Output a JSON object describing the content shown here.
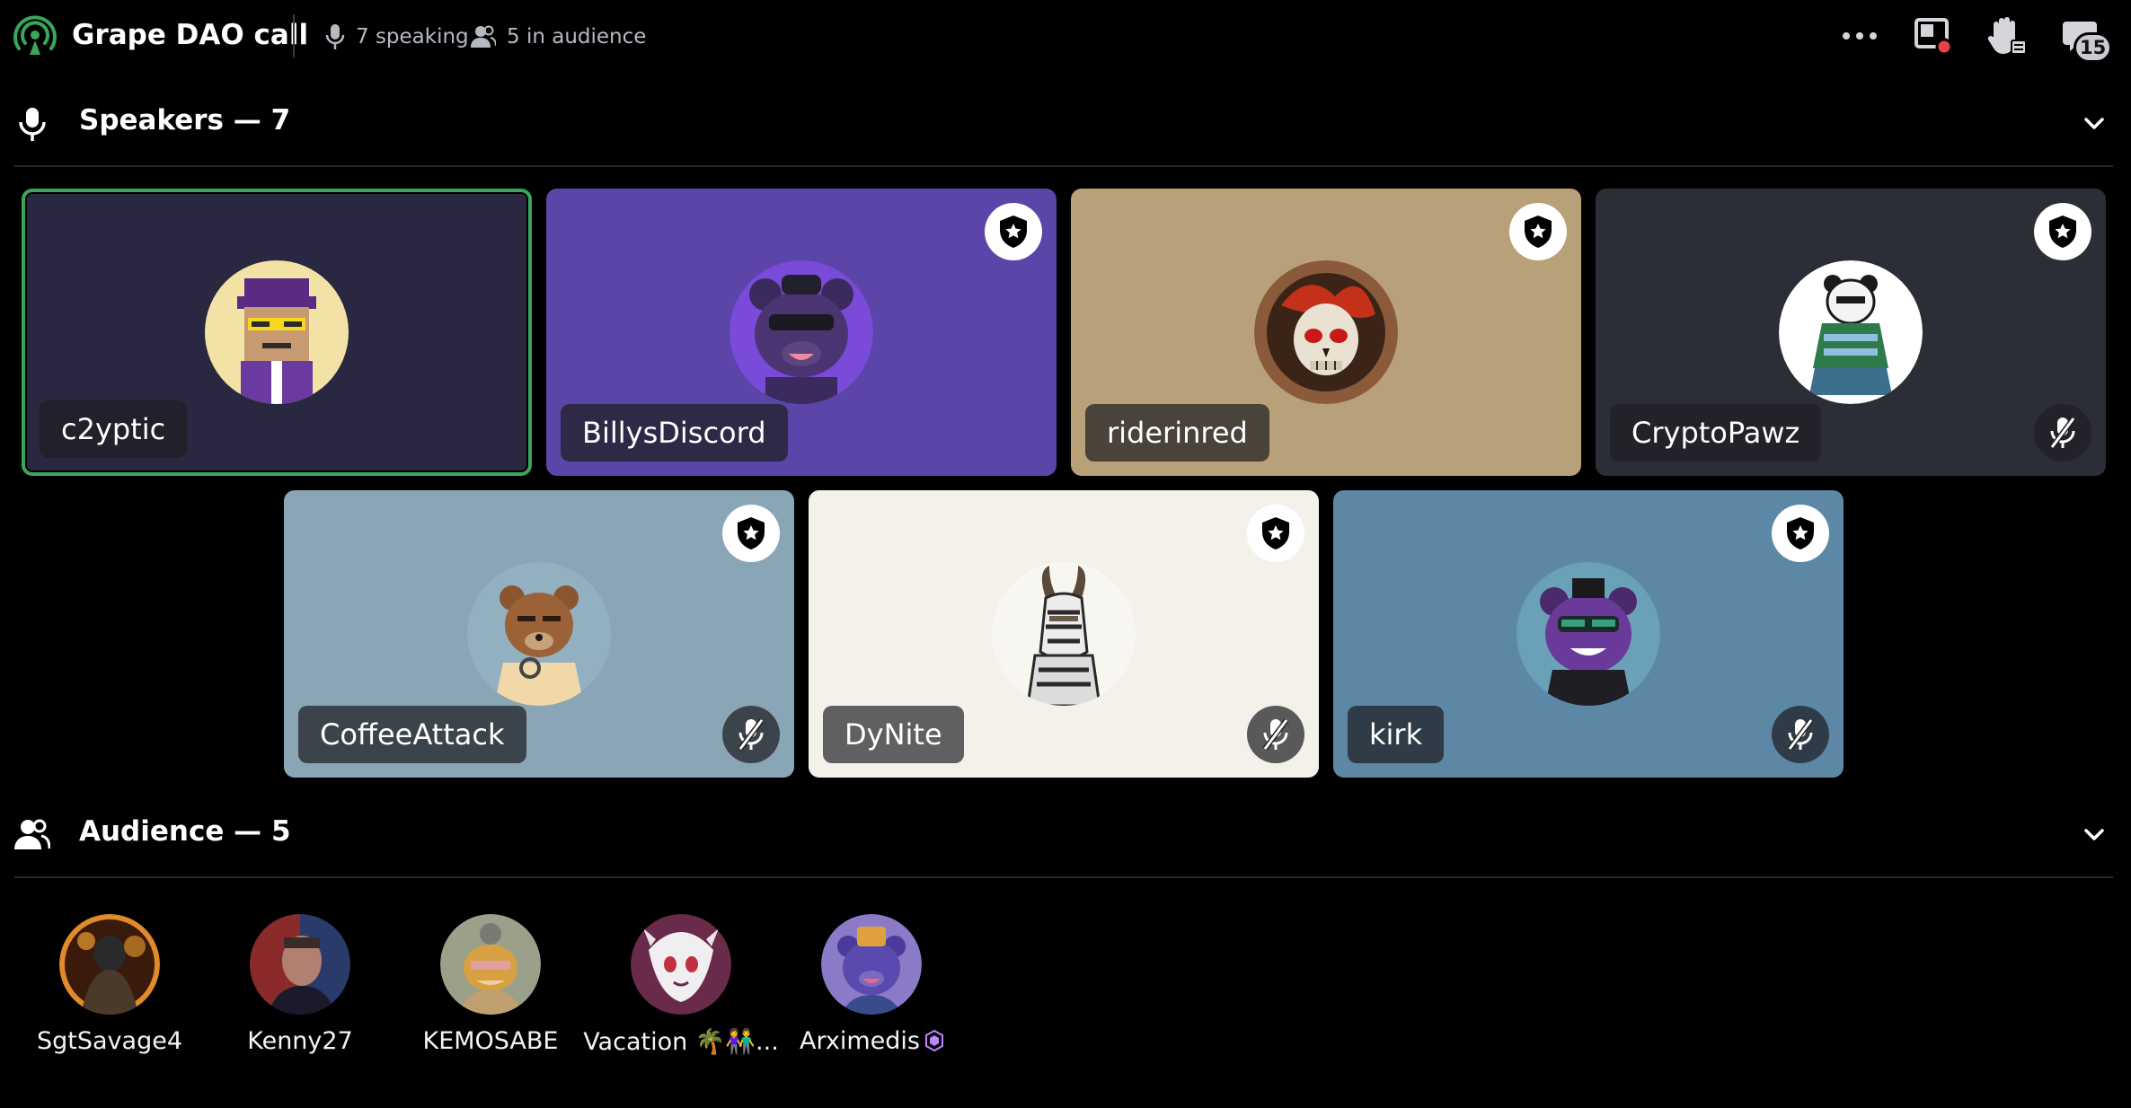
{
  "header": {
    "title": "Grape DAO call",
    "speaking": "7 speaking",
    "in_audience": "5 in audience",
    "chat_badge": "15"
  },
  "icons": {
    "stage": "stage-channel-icon",
    "mic": "microphone-icon",
    "people": "people-icon",
    "more": "more-options-icon",
    "screen": "screen-share-icon",
    "hand": "raise-hand-icon",
    "chat": "chat-icon",
    "moderator": "moderator-shield-icon",
    "muted": "muted-mic-icon"
  },
  "colors": {
    "accent_green": "#3ba55c",
    "stage_green": "#3ba55c",
    "nitro_pink": "#c084fc"
  },
  "speakers": {
    "label": "Speakers — 7",
    "items": [
      {
        "name": "c2yptic",
        "tile_color": "#2a2740",
        "moderator": false,
        "muted": false,
        "speaking": true
      },
      {
        "name": "BillysDiscord",
        "tile_color": "#5b45a8",
        "moderator": true,
        "muted": false,
        "speaking": false
      },
      {
        "name": "riderinred",
        "tile_color": "#b8a078",
        "moderator": true,
        "muted": false,
        "speaking": false
      },
      {
        "name": "CryptoPawz",
        "tile_color": "#2b2e36",
        "moderator": true,
        "muted": true,
        "speaking": false
      },
      {
        "name": "CoffeeAttack",
        "tile_color": "#8aa5b5",
        "moderator": true,
        "muted": true,
        "speaking": false
      },
      {
        "name": "DyNite",
        "tile_color": "#f3f1ea",
        "moderator": true,
        "muted": true,
        "speaking": false
      },
      {
        "name": "kirk",
        "tile_color": "#5c88a6",
        "moderator": true,
        "muted": true,
        "speaking": false
      }
    ]
  },
  "audience": {
    "label": "Audience — 5",
    "items": [
      {
        "name": "SgtSavage4"
      },
      {
        "name": "Kenny27"
      },
      {
        "name": "KEMOSABE"
      },
      {
        "name": "Vacation 🌴👫..."
      },
      {
        "name": "Arximedis"
      }
    ]
  }
}
